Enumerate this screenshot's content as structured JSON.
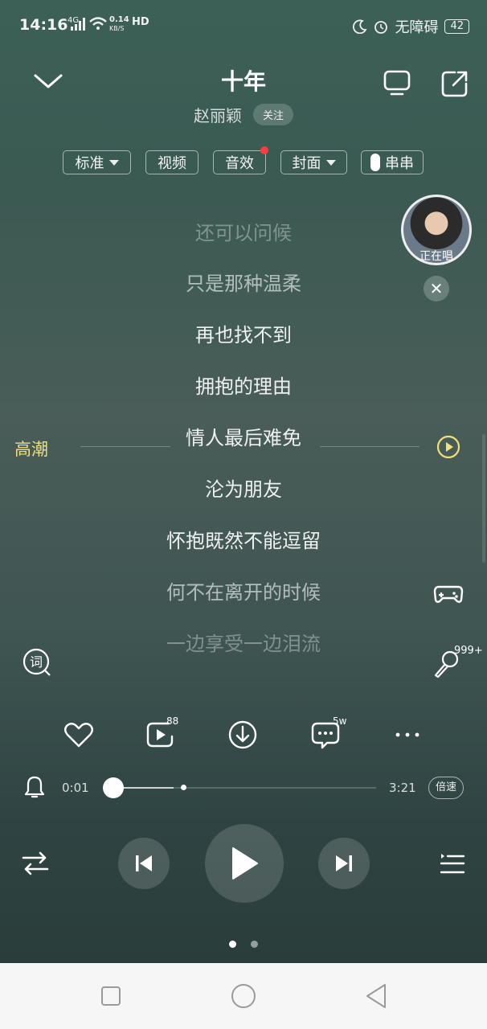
{
  "status_bar": {
    "time": "14:16",
    "network_top": "0.14",
    "network_bottom": "KB/S",
    "network_type": "4G",
    "hd": "HD",
    "accessibility": "无障碍",
    "battery": "42"
  },
  "header": {
    "title": "十年",
    "artist": "赵丽颖",
    "follow_label": "关注"
  },
  "chips": {
    "standard": "标准",
    "video": "视频",
    "sound_effect": "音效",
    "cover": "封面",
    "chuanchuan": "串串"
  },
  "lyrics": [
    {
      "text": "还可以问候"
    },
    {
      "text": "只是那种温柔"
    },
    {
      "text": "再也找不到"
    },
    {
      "text": "拥抱的理由"
    },
    {
      "text": "情人最后难免"
    },
    {
      "text": "沦为朋友"
    },
    {
      "text": "怀抱既然不能逗留"
    },
    {
      "text": "何不在离开的时候"
    },
    {
      "text": "一边享受一边泪流"
    }
  ],
  "climax": {
    "label": "高潮"
  },
  "singing_now": {
    "label": "正在唱"
  },
  "side": {
    "mic_count": "999+",
    "lyric_icon_char": "词"
  },
  "actions": {
    "mv_count": "88",
    "comment_count": "5w"
  },
  "progress": {
    "current": "0:01",
    "total": "3:21",
    "speed_label": "倍速",
    "fraction": 0.005
  },
  "pager": {
    "pages": 2,
    "active": 0
  },
  "colors": {
    "climax_accent": "#f1df7a",
    "badge_red": "#ff3b3b"
  }
}
